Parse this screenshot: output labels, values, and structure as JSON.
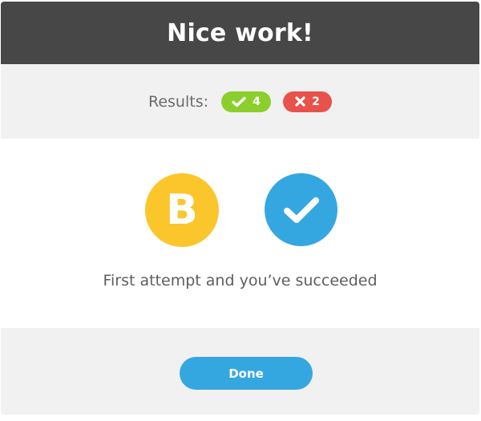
{
  "dialog": {
    "title": "Nice work!"
  },
  "results": {
    "label": "Results:",
    "correct": {
      "icon": "check-icon",
      "count": "4",
      "color": "#8bcf2c"
    },
    "wrong": {
      "icon": "x-icon",
      "count": "2",
      "color": "#e8524a"
    }
  },
  "badges": {
    "grade": {
      "letter": "B",
      "color": "#fbc62c"
    },
    "status": {
      "icon": "check-icon",
      "color": "#35a7e0"
    }
  },
  "message": "First attempt and you’ve succeeded",
  "footer": {
    "done_label": "Done",
    "button_color": "#35a7e0"
  },
  "colors": {
    "header_bg": "#474747",
    "panel_bg": "#f1f1f1"
  }
}
